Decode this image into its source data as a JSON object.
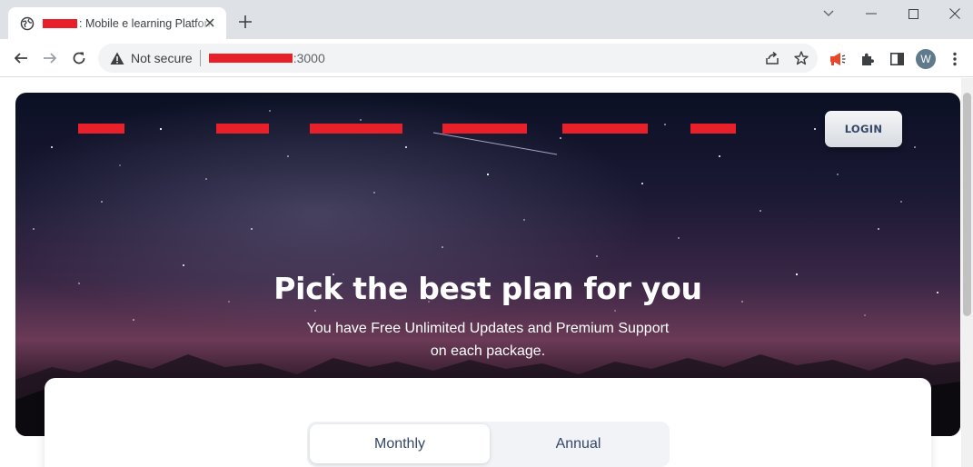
{
  "browser": {
    "tab_title": ": Mobile e learning Platform",
    "omnibox": {
      "security": "Not secure",
      "url_suffix": ":3000"
    },
    "profile_initial": "W"
  },
  "page": {
    "login_label": "LOGIN",
    "hero": {
      "title": "Pick the best plan for you",
      "subtitle_line1": "You have Free Unlimited Updates and Premium Support",
      "subtitle_line2": "on each package."
    },
    "pricing_toggle": {
      "options": [
        "Monthly",
        "Annual"
      ],
      "selected": "Monthly"
    }
  }
}
